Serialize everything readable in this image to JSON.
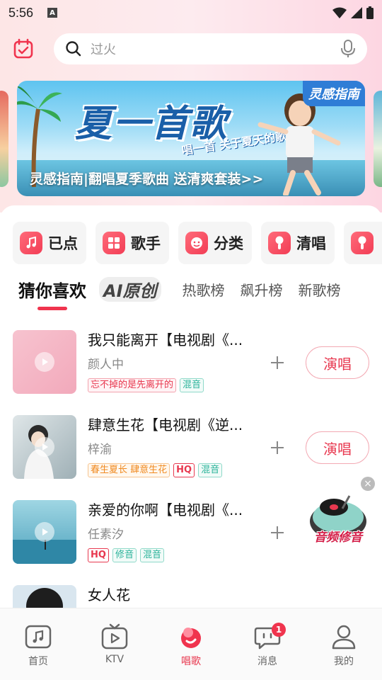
{
  "status_bar": {
    "time": "5:56",
    "app_icon": "A"
  },
  "search": {
    "placeholder": "过火"
  },
  "banner": {
    "title": "夏一首歌",
    "subtitle": "唱一首 关于夏天的歌~",
    "tag": "灵感指南",
    "caption": "灵感指南|翻唱夏季歌曲 送清爽套装>>"
  },
  "categories": [
    {
      "label": "已点",
      "icon": "music-note-icon"
    },
    {
      "label": "歌手",
      "icon": "grid-icon"
    },
    {
      "label": "分类",
      "icon": "face-icon"
    },
    {
      "label": "清唱",
      "icon": "mic-icon"
    },
    {
      "label": "",
      "icon": "mic-icon"
    }
  ],
  "tabs": [
    {
      "label": "猜你喜欢",
      "active": true
    },
    {
      "label": "AI原创",
      "active": false
    },
    {
      "label": "热歌榜",
      "active": false
    },
    {
      "label": "飙升榜",
      "active": false
    },
    {
      "label": "新歌榜",
      "active": false
    }
  ],
  "songs": [
    {
      "title": "我只能离开【电视剧《...",
      "artist": "颜人中",
      "tags": [
        {
          "text": "忘不掉的是先离开的",
          "style": "red"
        },
        {
          "text": "混音",
          "style": "green"
        }
      ],
      "cover_color": "#f4b7c6"
    },
    {
      "title": "肆意生花【电视剧《逆...",
      "artist": "梓渝",
      "tags": [
        {
          "text": "春生夏长 肆意生花",
          "style": "orange"
        },
        {
          "text": "HQ",
          "style": "hq"
        },
        {
          "text": "混音",
          "style": "green"
        }
      ],
      "cover_color": "#c9d3d6"
    },
    {
      "title": "亲爱的你啊【电视剧《...",
      "artist": "任素汐",
      "tags": [
        {
          "text": "HQ",
          "style": "hq"
        },
        {
          "text": "修音",
          "style": "green"
        },
        {
          "text": "混音",
          "style": "green"
        }
      ],
      "cover_color": "#6db6c9"
    },
    {
      "title": "女人花",
      "artist": "",
      "tags": [],
      "cover_color": "#d9e6ef"
    }
  ],
  "sing_label": "演唱",
  "promo": {
    "label": "音频修音"
  },
  "bottom_nav": [
    {
      "label": "首页",
      "icon": "home-icon"
    },
    {
      "label": "KTV",
      "icon": "tv-icon"
    },
    {
      "label": "唱歌",
      "icon": "sing-icon",
      "active": true
    },
    {
      "label": "消息",
      "icon": "message-icon",
      "badge": "1"
    },
    {
      "label": "我的",
      "icon": "profile-icon"
    }
  ],
  "colors": {
    "accent": "#e8384f",
    "banner_sky": "#5ec4f0"
  }
}
